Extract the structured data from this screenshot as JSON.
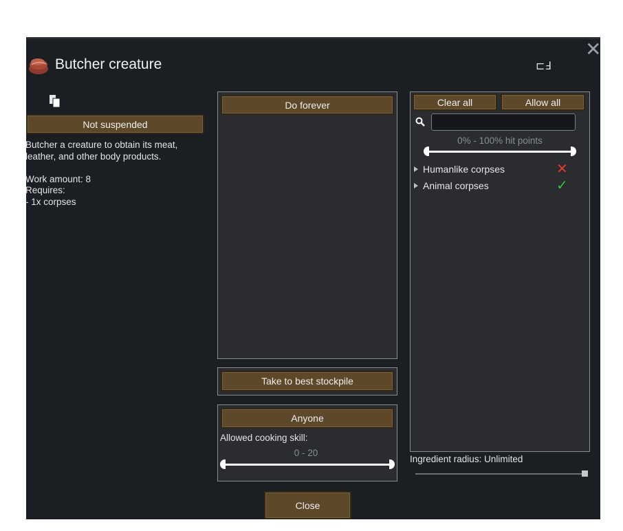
{
  "dialog": {
    "title": "Butcher creature",
    "close_glyph": "✕",
    "rename_glyph": "⊏Ⅎ"
  },
  "left": {
    "suspend_label": "Not suspended",
    "description": "Butcher a creature to obtain its meat,\nleather, and other body products.\n\nWork amount: 8\nRequires:\n - 1x corpses"
  },
  "middle": {
    "repeat_mode_label": "Do forever",
    "store_mode_label": "Take to best stockpile",
    "worker_label": "Anyone",
    "skill_label": "Allowed cooking skill:",
    "skill_range": "0 - 20",
    "skill_min": 0,
    "skill_max": 20,
    "close_label": "Close"
  },
  "filter": {
    "clear_all_label": "Clear all",
    "allow_all_label": "Allow all",
    "search_placeholder": "",
    "hitpoints_range": "0% - 100% hit points",
    "hitpoints_min": 0,
    "hitpoints_max": 100,
    "items": [
      {
        "label": "Humanlike corpses",
        "allowed": false,
        "icon": "red-cross-icon",
        "color": "#e23b2e"
      },
      {
        "label": "Animal corpses",
        "allowed": true,
        "icon": "green-check-icon",
        "color": "#37c33b"
      }
    ],
    "ingredient_radius_label": "Ingredient radius: Unlimited",
    "ingredient_radius_fraction": 1.0
  },
  "colors": {
    "button_fill": "#5d4929",
    "window_bg": "#1b1f24",
    "panel_bg": "#2a2c30"
  }
}
